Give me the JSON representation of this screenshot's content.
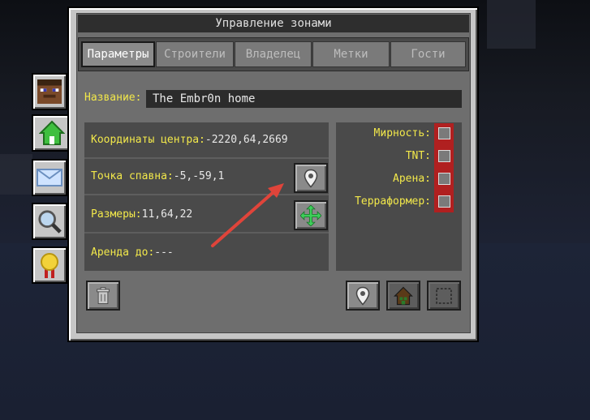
{
  "window": {
    "title": "Управление зонами"
  },
  "tabs": [
    {
      "label": "Параметры",
      "active": true
    },
    {
      "label": "Строители",
      "active": false
    },
    {
      "label": "Владелец",
      "active": false
    },
    {
      "label": "Метки",
      "active": false
    },
    {
      "label": "Гости",
      "active": false
    }
  ],
  "side_tabs": [
    {
      "icon": "player-head-icon"
    },
    {
      "icon": "house-icon",
      "active": true
    },
    {
      "icon": "envelope-icon"
    },
    {
      "icon": "magnifier-icon"
    },
    {
      "icon": "medal-icon"
    }
  ],
  "name": {
    "label": "Название:",
    "value": "The Embr0n home"
  },
  "info": {
    "center": {
      "label": "Координаты центра:",
      "value": " -2220,64,2669"
    },
    "spawn": {
      "label": "Точка спавна:",
      "value": " -5,-59,1"
    },
    "size": {
      "label": "Размеры:",
      "value": " 11,64,22"
    },
    "rent": {
      "label": "Аренда до:",
      "value": " ---"
    }
  },
  "flags": [
    {
      "label": "Мирность:",
      "checked": false
    },
    {
      "label": "TNT:",
      "checked": false
    },
    {
      "label": "Арена:",
      "checked": false
    },
    {
      "label": "Терраформер:",
      "checked": false
    }
  ],
  "colors": {
    "label_yellow": "#f2e84a",
    "checkbox_strip": "#b02020",
    "annotation_arrow": "#e0443a"
  }
}
